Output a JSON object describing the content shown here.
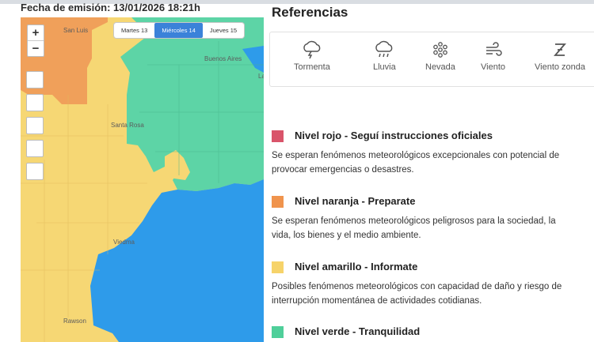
{
  "header": {
    "emission": "Fecha de emisión: 13/01/2026 18:21h"
  },
  "map": {
    "zoom_in": "+",
    "zoom_out": "−",
    "days": [
      {
        "label": "Martes 13",
        "selected": false
      },
      {
        "label": "Miércoles 14",
        "selected": true
      },
      {
        "label": "Jueves 15",
        "selected": false
      }
    ],
    "places": {
      "san_luis": "San Luis",
      "buenos_aires": "Buenos Aires",
      "la": "La",
      "santa_rosa": "Santa Rosa",
      "viedma": "Viedma",
      "rawson": "Rawson"
    },
    "colors": {
      "orange": "#f0a05a",
      "yellow": "#f6d774",
      "green": "#5dd4a6",
      "blue": "#2e9bea"
    }
  },
  "references": {
    "title": "Referencias",
    "icons": [
      {
        "name": "tormenta-icon",
        "label": "Tormenta"
      },
      {
        "name": "lluvia-icon",
        "label": "Lluvia"
      },
      {
        "name": "nevada-icon",
        "label": "Nevada"
      },
      {
        "name": "viento-icon",
        "label": "Viento"
      },
      {
        "name": "viento-zonda-icon",
        "label": "Viento zonda"
      }
    ],
    "levels": [
      {
        "color": "#d9546a",
        "title": "Nivel rojo - Seguí instrucciones oficiales",
        "desc1": "Se esperan fenómenos meteorológicos excepcionales con potencial de",
        "desc2": "provocar emergencias o desastres."
      },
      {
        "color": "#f0944d",
        "title": "Nivel naranja - Preparate",
        "desc1": "Se esperan fenómenos meteorológicos peligrosos para la sociedad, la",
        "desc2": "vida, los bienes y el medio ambiente."
      },
      {
        "color": "#f6d36a",
        "title": "Nivel amarillo - Informate",
        "desc1": "Posibles fenómenos meteorológicos con capacidad de daño y riesgo de",
        "desc2": "interrupción momentánea de actividades cotidianas."
      },
      {
        "color": "#4fcf9a",
        "title": "Nivel verde - Tranquilidad"
      }
    ]
  }
}
